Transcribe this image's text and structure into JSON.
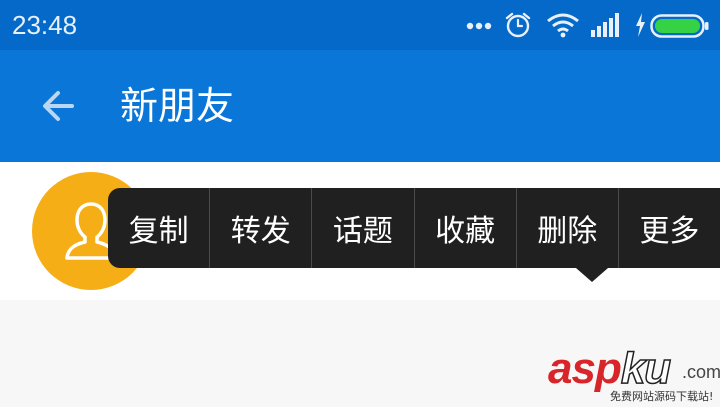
{
  "status_bar": {
    "time": "23:48",
    "icons": [
      "more-dots-icon",
      "alarm-icon",
      "wifi-icon",
      "signal-icon",
      "charging-icon",
      "battery-icon"
    ],
    "battery_color": "#35d246"
  },
  "app_bar": {
    "title": "新朋友",
    "back_icon": "arrow-left-icon",
    "background": "#0a77d8"
  },
  "friend": {
    "avatar_icon": "person-icon",
    "avatar_color": "#f6ae17"
  },
  "context_menu": {
    "items": [
      "复制",
      "转发",
      "话题",
      "收藏",
      "删除",
      "更多"
    ]
  },
  "watermark": {
    "asp": "asp",
    "ku": "ku",
    "com": ".com",
    "subtitle": "免费网站源码下载站!"
  }
}
